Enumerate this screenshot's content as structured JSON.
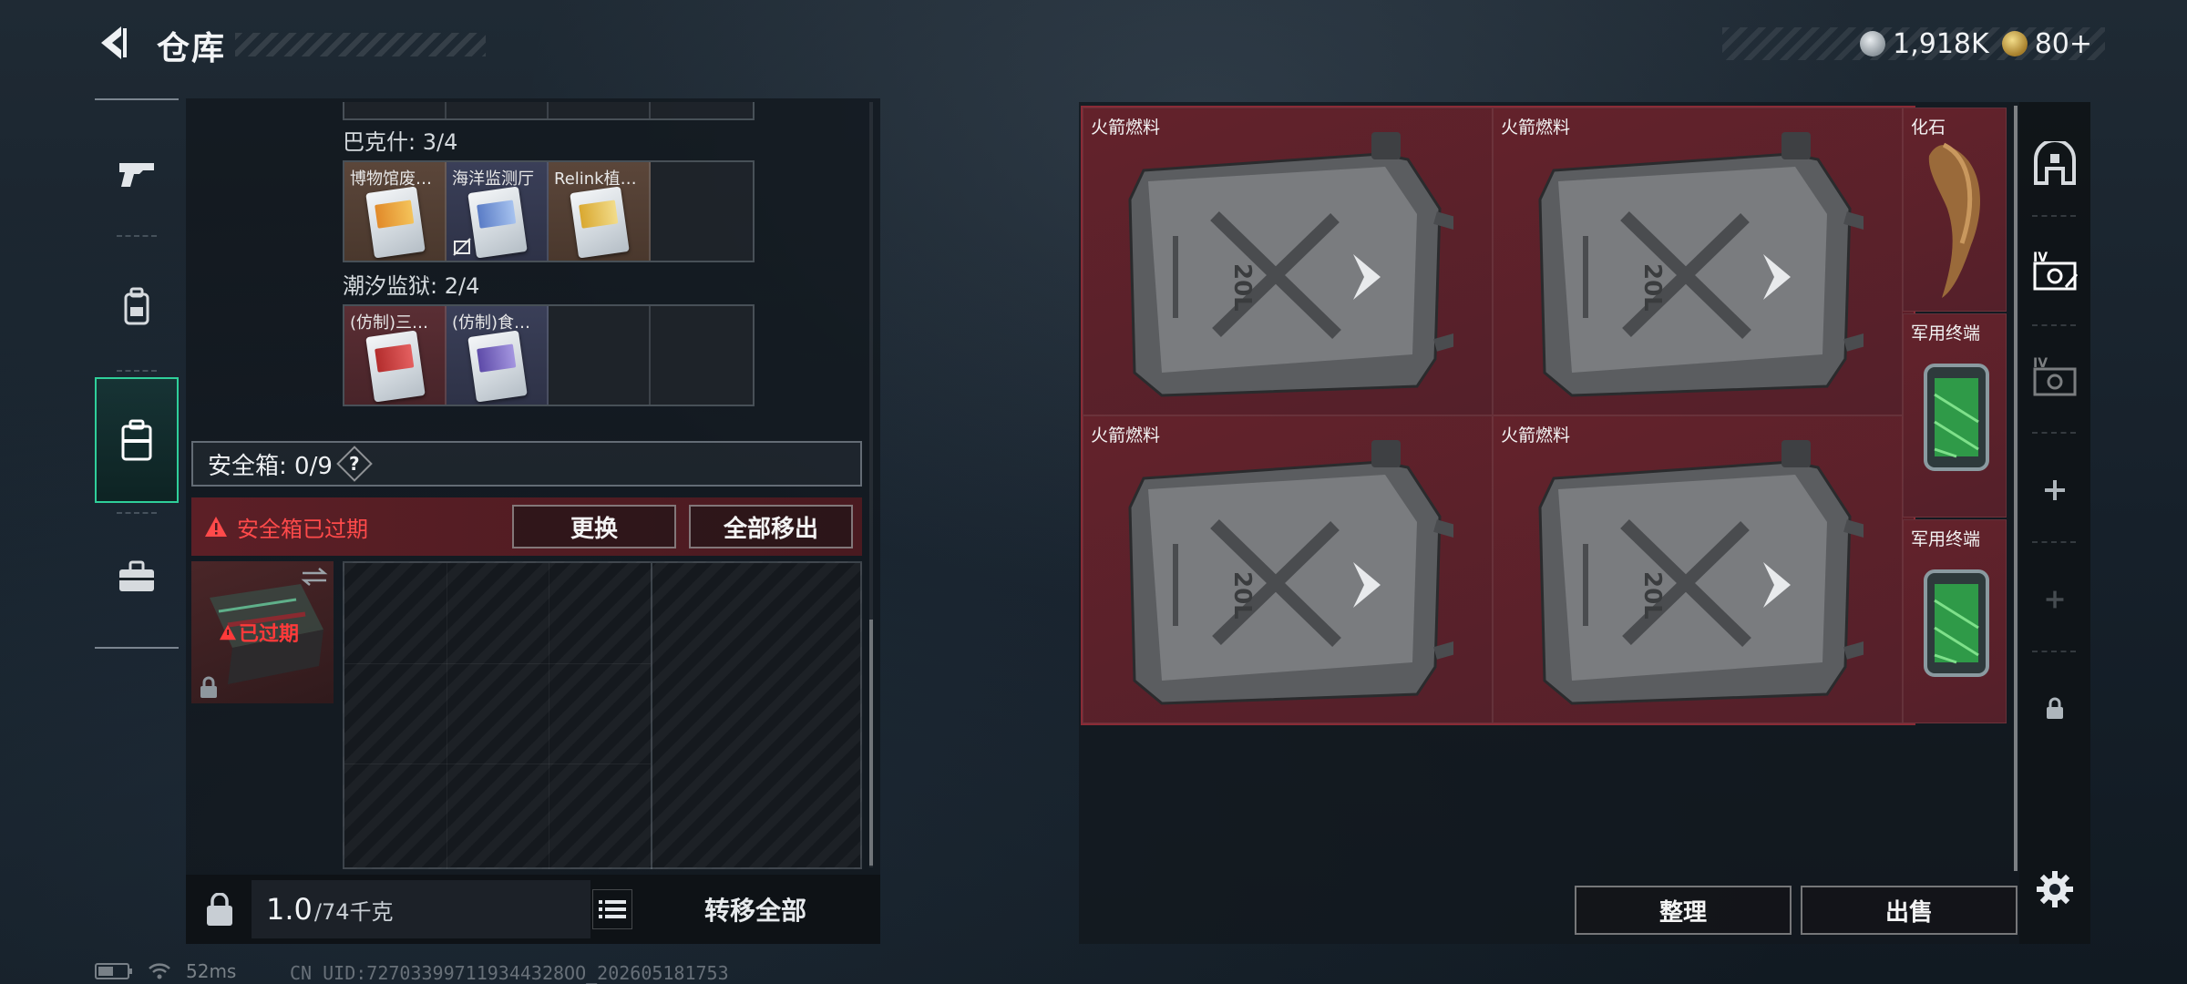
{
  "header": {
    "title": "仓库",
    "currencies": [
      {
        "icon": "silver-coin-icon",
        "value": "1,918K"
      },
      {
        "icon": "gold-coin-icon",
        "value": "80+"
      }
    ]
  },
  "left_tabs": [
    {
      "name": "weapons",
      "icon": "pistol-icon",
      "active": false
    },
    {
      "name": "equipment",
      "icon": "backpack-icon",
      "active": false
    },
    {
      "name": "safe",
      "icon": "case-icon",
      "active": true
    },
    {
      "name": "briefcase",
      "icon": "briefcase-icon",
      "active": false
    }
  ],
  "groups": [
    {
      "label": "巴克什: 3/4",
      "slots": [
        {
          "label": "博物馆废…",
          "tint": "orange",
          "card": "o",
          "nosell": false
        },
        {
          "label": "海洋监测厅",
          "tint": "navy",
          "card": "b",
          "nosell": true
        },
        {
          "label": "Relink植…",
          "tint": "orange",
          "card": "y",
          "nosell": false
        },
        {
          "label": "",
          "tint": "empty",
          "card": "",
          "nosell": false
        }
      ]
    },
    {
      "label": "潮汐监狱: 2/4",
      "slots": [
        {
          "label": "(仿制)三…",
          "tint": "red",
          "card": "r",
          "nosell": false
        },
        {
          "label": "(仿制)食…",
          "tint": "navy",
          "card": "p",
          "nosell": false
        },
        {
          "label": "",
          "tint": "empty",
          "card": "",
          "nosell": false
        },
        {
          "label": "",
          "tint": "empty",
          "card": "",
          "nosell": false
        }
      ]
    }
  ],
  "safe_box": {
    "label": "安全箱: 0/9",
    "help": "?",
    "warning": "安全箱已过期",
    "replace_button": "更换",
    "remove_all_button": "全部移出",
    "expired_label": "已过期"
  },
  "weight": {
    "current": "1.0",
    "max": "/74千克"
  },
  "transfer_all_button": "转移全部",
  "stash": {
    "items": [
      {
        "label": "火箭燃料",
        "kind": "jerrycan"
      },
      {
        "label": "火箭燃料",
        "kind": "jerrycan"
      },
      {
        "label": "火箭燃料",
        "kind": "jerrycan"
      },
      {
        "label": "火箭燃料",
        "kind": "jerrycan"
      },
      {
        "label": "化石",
        "kind": "fossil"
      },
      {
        "label": "军用终端",
        "kind": "terminal"
      },
      {
        "label": "军用终端",
        "kind": "terminal"
      }
    ],
    "jerrycan_text": "20L",
    "sort_button": "整理",
    "sell_button": "出售"
  },
  "status": {
    "ping": "52ms",
    "uid": "CN UID:727033997119344328OO_202605181753"
  },
  "colors": {
    "accent": "#2fcf9a",
    "warning": "#ff4a4a",
    "stash_red": "#5d1f28"
  }
}
